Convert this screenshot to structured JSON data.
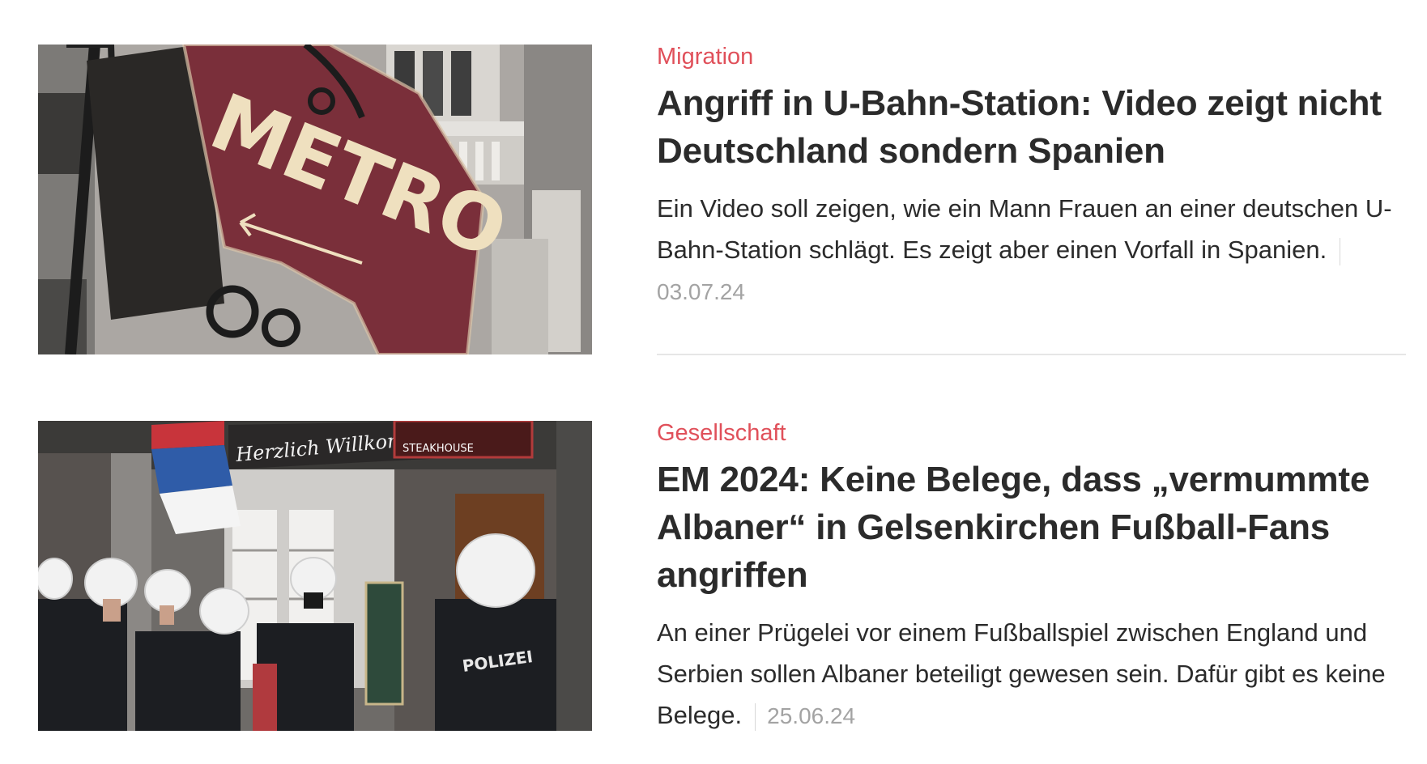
{
  "articles": [
    {
      "category": "Migration",
      "headline": "Angriff in U-Bahn-Station: Video zeigt nicht Deutschland sondern Spanien",
      "teaser": "Ein Video soll zeigen, wie ein Mann Frauen an einer deutschen U-Bahn-Station schlägt. Es zeigt aber einen Vorfall in Spanien.",
      "date": "03.07.24",
      "image": {
        "sign_text": "METRO"
      }
    },
    {
      "category": "Gesellschaft",
      "headline": "EM 2024: Keine Belege, dass „vermummte Albaner“ in Gelsenkirchen Fußball-Fans angriffen",
      "teaser": "An einer Prügelei vor einem Fußballspiel zwischen England und Serbien sollen Albaner beteiligt gewesen sein. Dafür gibt es keine Belege.",
      "date": "25.06.24",
      "image": {
        "awning_text": "Herzlich Willkommen",
        "steakhouse_text": "STEAKHOUSE",
        "vest_text": "POLIZEI"
      }
    }
  ],
  "colors": {
    "category": "#e0505a",
    "headline": "#2b2b2b",
    "date": "#a3a3a3",
    "divider": "#e6e6e6"
  }
}
